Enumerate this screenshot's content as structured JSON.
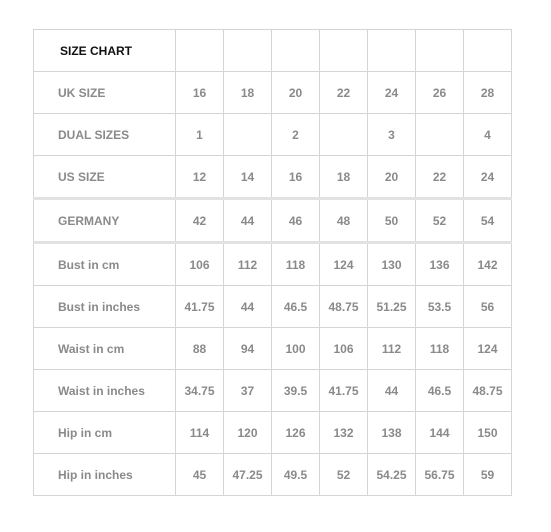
{
  "title": "SIZE CHART",
  "rows": [
    {
      "label": "UK SIZE",
      "values": [
        "16",
        "18",
        "20",
        "22",
        "24",
        "26",
        "28"
      ]
    },
    {
      "label": "DUAL SIZES",
      "values": [
        "1",
        "",
        "2",
        "",
        "3",
        "",
        "4"
      ]
    },
    {
      "label": "US SIZE",
      "values": [
        "12",
        "14",
        "16",
        "18",
        "20",
        "22",
        "24"
      ]
    },
    {
      "label": "GERMANY",
      "values": [
        "42",
        "44",
        "46",
        "48",
        "50",
        "52",
        "54"
      ]
    },
    {
      "label": "Bust in cm",
      "values": [
        "106",
        "112",
        "118",
        "124",
        "130",
        "136",
        "142"
      ]
    },
    {
      "label": "Bust in inches",
      "values": [
        "41.75",
        "44",
        "46.5",
        "48.75",
        "51.25",
        "53.5",
        "56"
      ]
    },
    {
      "label": "Waist in cm",
      "values": [
        "88",
        "94",
        "100",
        "106",
        "112",
        "118",
        "124"
      ]
    },
    {
      "label": "Waist in inches",
      "values": [
        "34.75",
        "37",
        "39.5",
        "41.75",
        "44",
        "46.5",
        "48.75"
      ]
    },
    {
      "label": "Hip in cm",
      "values": [
        "114",
        "120",
        "126",
        "132",
        "138",
        "144",
        "150"
      ]
    },
    {
      "label": "Hip in inches",
      "values": [
        "45",
        "47.25",
        "49.5",
        "52",
        "54.25",
        "56.75",
        "59"
      ]
    }
  ],
  "colors": {
    "title_text": "#111111",
    "cell_text": "#8a8a8a",
    "grid": "#d4d4d4"
  }
}
